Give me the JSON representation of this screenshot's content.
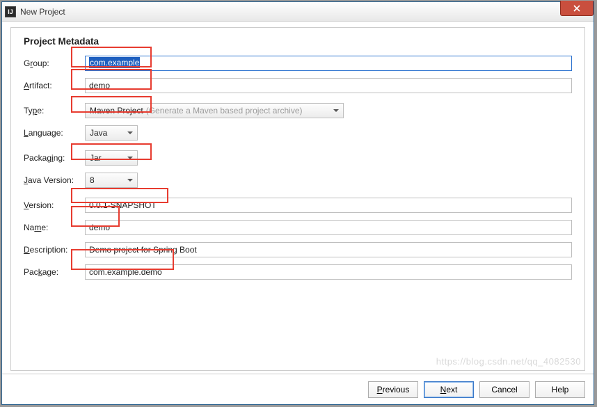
{
  "window": {
    "title": "New Project"
  },
  "section": {
    "title": "Project Metadata"
  },
  "labels": {
    "group_pre": "G",
    "group_ul": "r",
    "group_post": "oup:",
    "artifact_ul": "A",
    "artifact_post": "rtifact:",
    "type_pre": "Ty",
    "type_ul": "p",
    "type_post": "e:",
    "language_ul": "L",
    "language_post": "anguage:",
    "packaging_pre": "Packag",
    "packaging_ul": "i",
    "packaging_post": "ng:",
    "javaversion_ul": "J",
    "javaversion_post": "ava Version:",
    "version_ul": "V",
    "version_post": "ersion:",
    "name_pre": "Na",
    "name_ul": "m",
    "name_post": "e:",
    "description_ul": "D",
    "description_post": "escription:",
    "package_pre": "Pac",
    "package_ul": "k",
    "package_post": "age:"
  },
  "fields": {
    "group": "com.example",
    "artifact": "demo",
    "type": "Maven Project",
    "type_hint": "(Generate a Maven based project archive)",
    "language": "Java",
    "packaging": "Jar",
    "javaversion": "8",
    "version": "0.0.1-SNAPSHOT",
    "name": "demo",
    "description": "Demo project for Spring Boot",
    "package": "com.example.demo"
  },
  "buttons": {
    "previous_ul": "P",
    "previous_post": "revious",
    "next_ul": "N",
    "next_post": "ext",
    "cancel": "Cancel",
    "help": "Help"
  },
  "watermark": "https://blog.csdn.net/qq_4082530"
}
